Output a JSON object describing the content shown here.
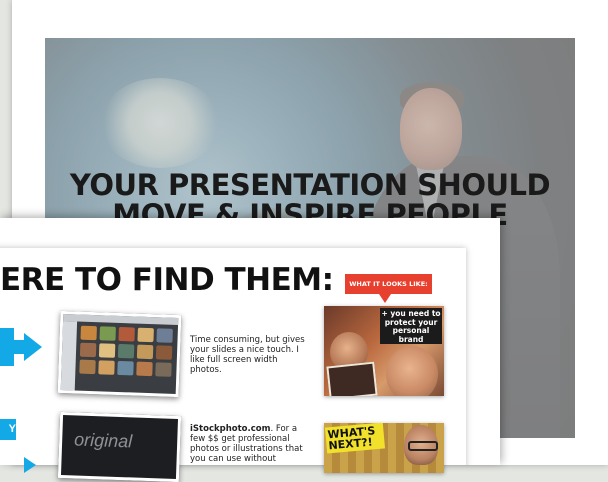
{
  "back_slide": {
    "title_line1": "YOUR PRESENTATION SHOULD",
    "title_line2": "MOVE & INSPIRE PEOPLE"
  },
  "front_slide": {
    "title": "ERE TO FIND THEM:",
    "badge": "WHAT IT LOOKS LIKE:",
    "side_label": "Y",
    "row1": {
      "description": "Time consuming, but gives your slides a nice touch. I like full screen width photos.",
      "example_caption": "+ you need to protect your personal brand"
    },
    "row2": {
      "site": "iStockphoto.com",
      "description_rest": ". For a few $$ get professional photos or illustrations that you can use without",
      "screenshot_logo": "original",
      "example_label": "WHAT'S NEXT?!"
    }
  }
}
